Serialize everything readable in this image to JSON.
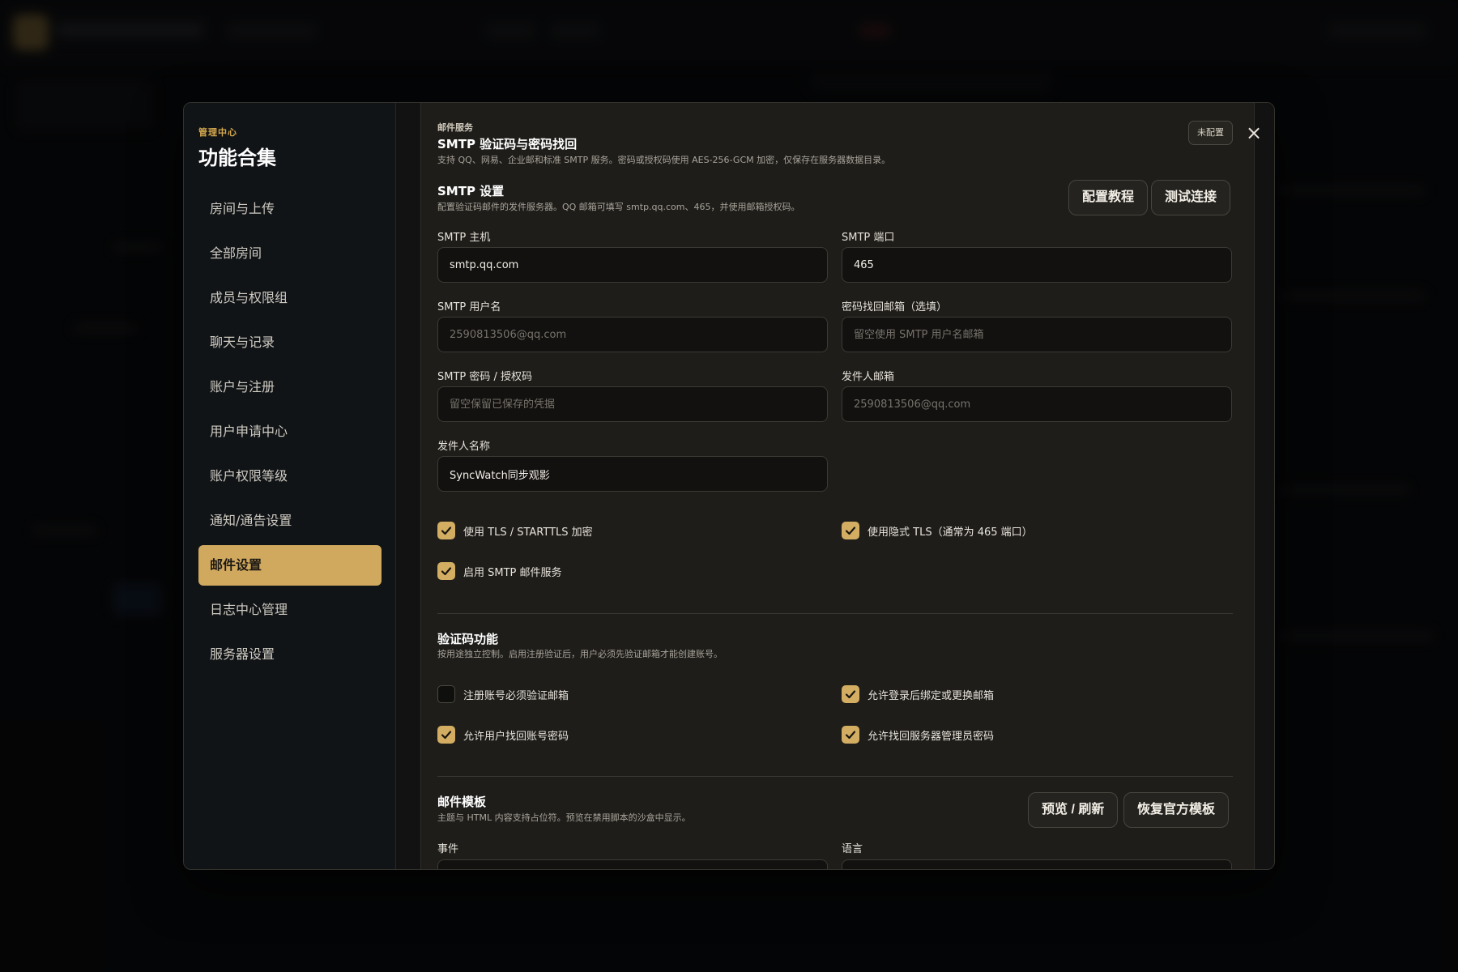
{
  "modal": {
    "eyebrow": "管理中心",
    "title": "功能合集",
    "close_icon": "×"
  },
  "sidebar": {
    "items": [
      {
        "label": "房间与上传"
      },
      {
        "label": "全部房间"
      },
      {
        "label": "成员与权限组"
      },
      {
        "label": "聊天与记录"
      },
      {
        "label": "账户与注册"
      },
      {
        "label": "用户申请中心"
      },
      {
        "label": "账户权限等级"
      },
      {
        "label": "通知/通告设置"
      },
      {
        "label": "邮件设置",
        "active": true
      },
      {
        "label": "日志中心管理"
      },
      {
        "label": "服务器设置"
      }
    ]
  },
  "header": {
    "eyebrow": "邮件服务",
    "title": "SMTP 验证码与密码找回",
    "description": "支持 QQ、网易、企业邮和标准 SMTP 服务。密码或授权码使用 AES-256-GCM 加密，仅保存在服务器数据目录。",
    "status_badge": "未配置"
  },
  "smtp": {
    "title": "SMTP 设置",
    "description": "配置验证码邮件的发件服务器。QQ 邮箱可填写 smtp.qq.com、465，并使用邮箱授权码。",
    "tutorial_button": "配置教程",
    "test_button": "测试连接",
    "host_label": "SMTP 主机",
    "host_value": "smtp.qq.com",
    "port_label": "SMTP 端口",
    "port_value": "465",
    "username_label": "SMTP 用户名",
    "username_placeholder": "2590813506@qq.com",
    "recovery_label": "密码找回邮箱（选填）",
    "recovery_placeholder": "留空使用 SMTP 用户名邮箱",
    "password_label": "SMTP 密码 / 授权码",
    "password_placeholder": "留空保留已保存的凭据",
    "sender_email_label": "发件人邮箱",
    "sender_email_placeholder": "2590813506@qq.com",
    "sender_name_label": "发件人名称",
    "sender_name_value": "SyncWatch同步观影",
    "tls_label": "使用 TLS / STARTTLS 加密",
    "implicit_tls_label": "使用隐式 TLS（通常为 465 端口）",
    "enable_label": "启用 SMTP 邮件服务"
  },
  "verification": {
    "title": "验证码功能",
    "description": "按用途独立控制。启用注册验证后，用户必须先验证邮箱才能创建账号。",
    "register_label": "注册账号必须验证邮箱",
    "bind_label": "允许登录后绑定或更换邮箱",
    "recover_user_label": "允许用户找回账号密码",
    "recover_admin_label": "允许找回服务器管理员密码"
  },
  "template": {
    "title": "邮件模板",
    "description": "主题与 HTML 内容支持占位符。预览在禁用脚本的沙盒中显示。",
    "preview_button": "预览 / 刷新",
    "restore_button": "恢复官方模板",
    "event_label": "事件",
    "language_label": "语言"
  },
  "colors": {
    "accent": "#d0a95f",
    "background": "#1e1d1a",
    "sidebar": "#111417"
  }
}
